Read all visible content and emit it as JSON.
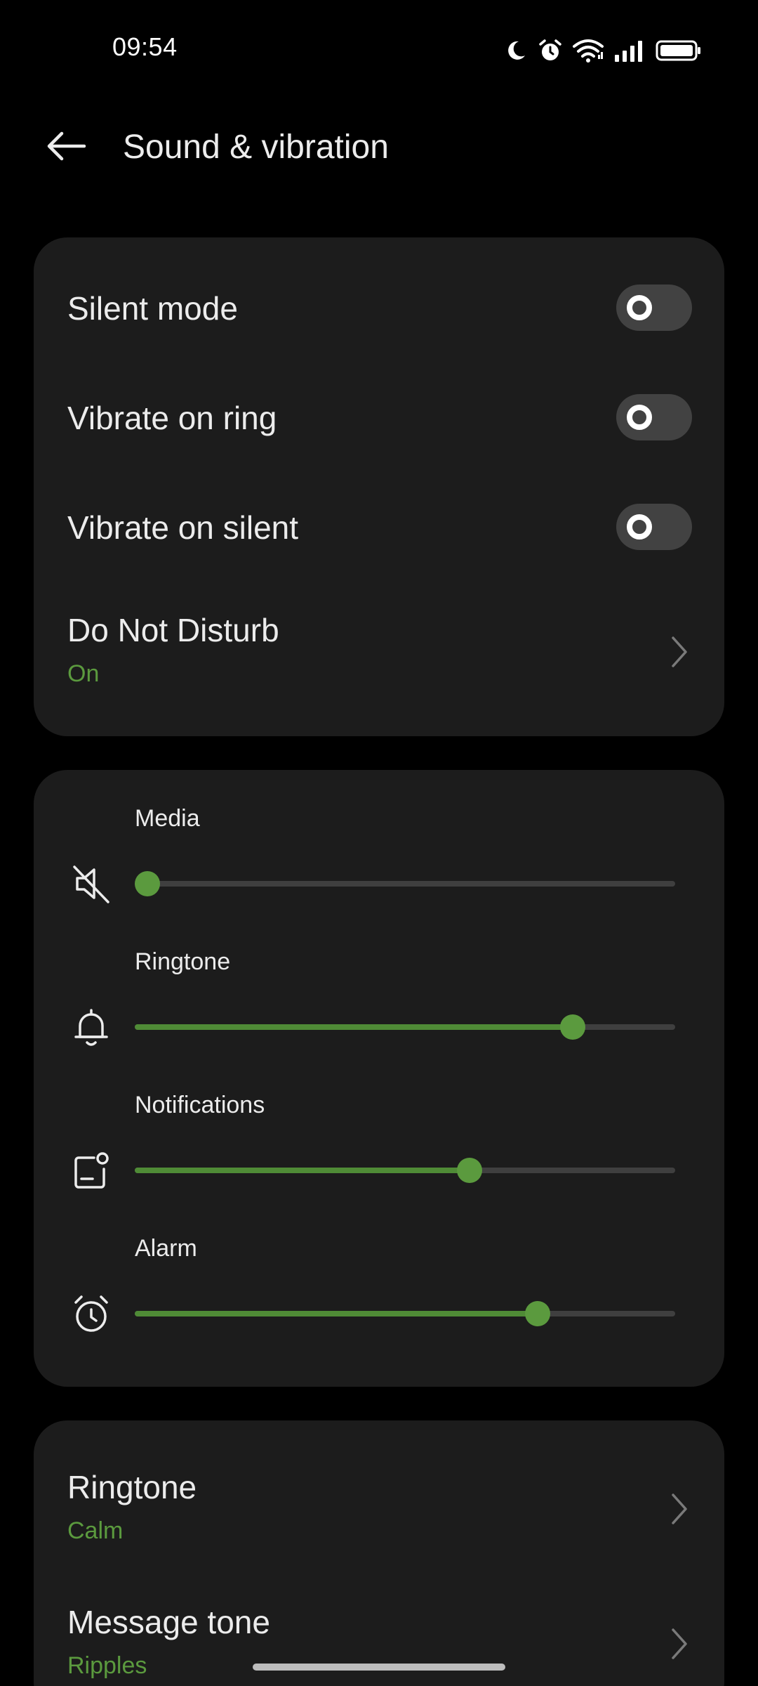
{
  "status_bar": {
    "time": "09:54",
    "icons": [
      "moon-icon",
      "alarm-icon",
      "wifi-icon",
      "signal-icon",
      "battery-icon"
    ]
  },
  "header": {
    "title": "Sound & vibration",
    "back_icon": "arrow-left-icon"
  },
  "toggles": {
    "silent_mode": {
      "label": "Silent mode",
      "on": false
    },
    "vibrate_on_ring": {
      "label": "Vibrate on ring",
      "on": false
    },
    "vibrate_on_silent": {
      "label": "Vibrate on silent",
      "on": false
    }
  },
  "dnd": {
    "label": "Do Not Disturb",
    "status": "On"
  },
  "volumes": {
    "media": {
      "label": "Media",
      "icon": "speaker-muted-icon",
      "level": 0.0
    },
    "ringtone": {
      "label": "Ringtone",
      "icon": "bell-icon",
      "level": 0.81
    },
    "notifications": {
      "label": "Notifications",
      "icon": "notification-icon",
      "level": 0.62
    },
    "alarm": {
      "label": "Alarm",
      "icon": "alarm-clock-icon",
      "level": 0.745
    }
  },
  "tones": {
    "ringtone": {
      "label": "Ringtone",
      "value": "Calm"
    },
    "message_tone": {
      "label": "Message tone",
      "value": "Ripples"
    }
  },
  "colors": {
    "accent": "#5b9a3e",
    "card_background": "#1c1c1c",
    "page_background": "#000000",
    "toggle_off": "#424242"
  }
}
